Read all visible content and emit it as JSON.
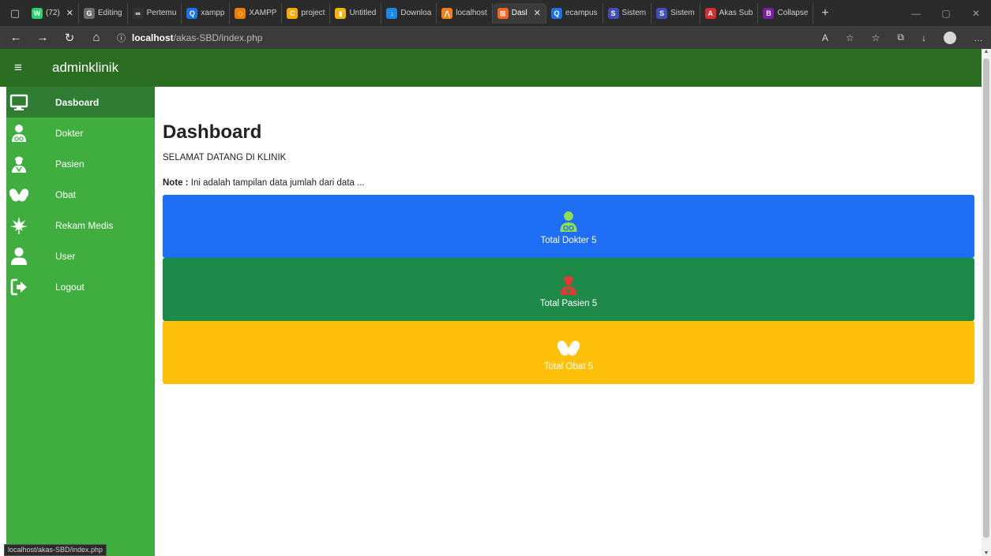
{
  "browser": {
    "tabs": [
      {
        "label": "(72)",
        "color": "#25d366",
        "glyph": "W"
      },
      {
        "label": "Editing",
        "color": "#6e6e6e",
        "glyph": "G"
      },
      {
        "label": "Pertemu",
        "color": "#333333",
        "glyph": "∞"
      },
      {
        "label": "xampp",
        "color": "#1a73e8",
        "glyph": "Q"
      },
      {
        "label": "XAMPP",
        "color": "#f57c00",
        "glyph": "◇"
      },
      {
        "label": "project",
        "color": "#f9ab00",
        "glyph": "C"
      },
      {
        "label": "Untitled",
        "color": "#f4b400",
        "glyph": "▮"
      },
      {
        "label": "Downloa",
        "color": "#1e88e5",
        "glyph": "↓"
      },
      {
        "label": "localhost",
        "color": "#f57f17",
        "glyph": "⋀"
      },
      {
        "label": "Dasl",
        "color": "#f26522",
        "glyph": "⊠",
        "active": true
      },
      {
        "label": "ecampus",
        "color": "#1a73e8",
        "glyph": "Q"
      },
      {
        "label": "Sistem",
        "color": "#3f51b5",
        "glyph": "S"
      },
      {
        "label": "Sistem",
        "color": "#3f51b5",
        "glyph": "S"
      },
      {
        "label": "Akas Sub",
        "color": "#d32f2f",
        "glyph": "A"
      },
      {
        "label": "Collapse",
        "color": "#7b1fa2",
        "glyph": "B"
      }
    ],
    "url_host": "localhost",
    "url_path": "/akas-SBD/index.php",
    "status_url": "localhost/akas-SBD/index.php"
  },
  "header": {
    "brand": "adminklinik"
  },
  "sidebar": {
    "items": [
      {
        "label": "Dasboard",
        "icon": "monitor-icon",
        "active": true
      },
      {
        "label": "Dokter",
        "icon": "doctor-icon"
      },
      {
        "label": "Pasien",
        "icon": "patient-icon"
      },
      {
        "label": "Obat",
        "icon": "pills-icon"
      },
      {
        "label": "Rekam Medis",
        "icon": "cannabis-leaf-icon"
      },
      {
        "label": "User",
        "icon": "user-icon"
      },
      {
        "label": "Logout",
        "icon": "logout-icon"
      }
    ]
  },
  "main": {
    "title": "Dashboard",
    "welcome": "SELAMAT DATANG DI KLINIK",
    "note_label": "Note :",
    "note_text": " Ini adalah tampilan data jumlah dari data ...",
    "cards": [
      {
        "label": "Total Dokter 5",
        "color": "#1e6ff5",
        "icon": "doctor-icon",
        "icon_color": "#8fe04a"
      },
      {
        "label": "Total Pasien 5",
        "color": "#1e8a49",
        "icon": "patient-icon",
        "icon_color": "#e53935"
      },
      {
        "label": "Total Obat 5",
        "color": "#ffc107",
        "icon": "pills-icon",
        "icon_color": "#ffffff"
      }
    ]
  }
}
